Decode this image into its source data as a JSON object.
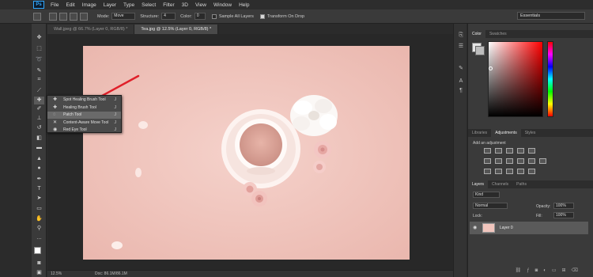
{
  "app": {
    "logo": "Ps"
  },
  "menu": [
    "File",
    "Edit",
    "Image",
    "Layer",
    "Type",
    "Select",
    "Filter",
    "3D",
    "View",
    "Window",
    "Help"
  ],
  "options": {
    "mode_label": "Mode:",
    "mode_value": "Move",
    "structure_label": "Structure:",
    "structure_value": "4",
    "color_label": "Color:",
    "color_value": "0",
    "sample_all_layers": "Sample All Layers",
    "transform_on_drop": "Transform On Drop",
    "workspace": "Essentials"
  },
  "tabs": [
    {
      "label": "Wall.jpeg @ 66.7% (Layer 0, RGB/8) *"
    },
    {
      "label": "Tea.jpg @ 12.5% (Layer 0, RGB/8) *"
    }
  ],
  "flyout": {
    "items": [
      {
        "label": "Spot Healing Brush Tool",
        "key": "J"
      },
      {
        "label": "Healing Brush Tool",
        "key": "J"
      },
      {
        "label": "Patch Tool",
        "key": "J"
      },
      {
        "label": "Content-Aware Move Tool",
        "key": "J"
      },
      {
        "label": "Red Eye Tool",
        "key": "J"
      }
    ]
  },
  "status": {
    "zoom": "12.5%",
    "doc": "Doc: 86.1M/86.1M"
  },
  "color_panel": {
    "tabs": [
      "Color",
      "Swatches"
    ]
  },
  "adjustments_panel": {
    "tabs": [
      "Libraries",
      "Adjustments",
      "Styles"
    ],
    "title": "Add an adjustment"
  },
  "layers_panel": {
    "tabs": [
      "Layers",
      "Channels",
      "Paths"
    ],
    "kind": "Kind",
    "blend_mode": "Normal",
    "opacity_label": "Opacity:",
    "opacity_value": "100%",
    "lock_label": "Lock:",
    "fill_label": "Fill:",
    "fill_value": "100%",
    "layer_name": "Layer 0"
  },
  "colors": {
    "annotation_arrow": "#e0202a",
    "canvas_bg": "#f1c5bd"
  }
}
